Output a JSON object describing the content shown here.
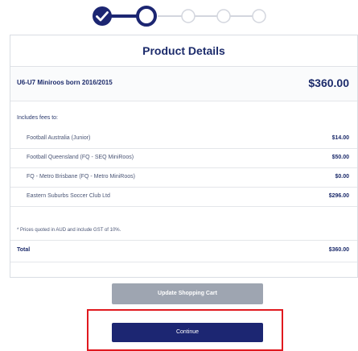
{
  "stepper": {
    "steps": 5,
    "completed_step": 1,
    "current_step": 2,
    "colors": {
      "active": "#1c2672",
      "inactive": "#d3d6de"
    },
    "icons": [
      "check-icon",
      "current-step-icon",
      "future-step-icon",
      "future-step-icon",
      "future-step-icon"
    ]
  },
  "card": {
    "title": "Product Details",
    "product": {
      "name": "U6-U7 Miniroos born 2016/2015",
      "price": "$360.00"
    },
    "includes_label": "Includes fees to:",
    "fees": [
      {
        "name": "Football Australia (Junior)",
        "amount": "$14.00"
      },
      {
        "name": "Football Queensland (FQ - SEQ MiniRoos)",
        "amount": "$50.00"
      },
      {
        "name": "FQ - Metro Brisbane (FQ - Metro MiniRoos)",
        "amount": "$0.00"
      },
      {
        "name": "Eastern Suburbs Soccer Club Ltd",
        "amount": "$296.00"
      }
    ],
    "note": "* Prices quoted in AUD and include GST of 10%.",
    "total": {
      "label": "Total",
      "amount": "$360.00"
    }
  },
  "buttons": {
    "update_label": "Update Shopping Cart",
    "continue_label": "Continue"
  },
  "colors": {
    "brand": "#1c2672",
    "update_button": "#9ea5b1",
    "highlight": "#e0191f"
  }
}
